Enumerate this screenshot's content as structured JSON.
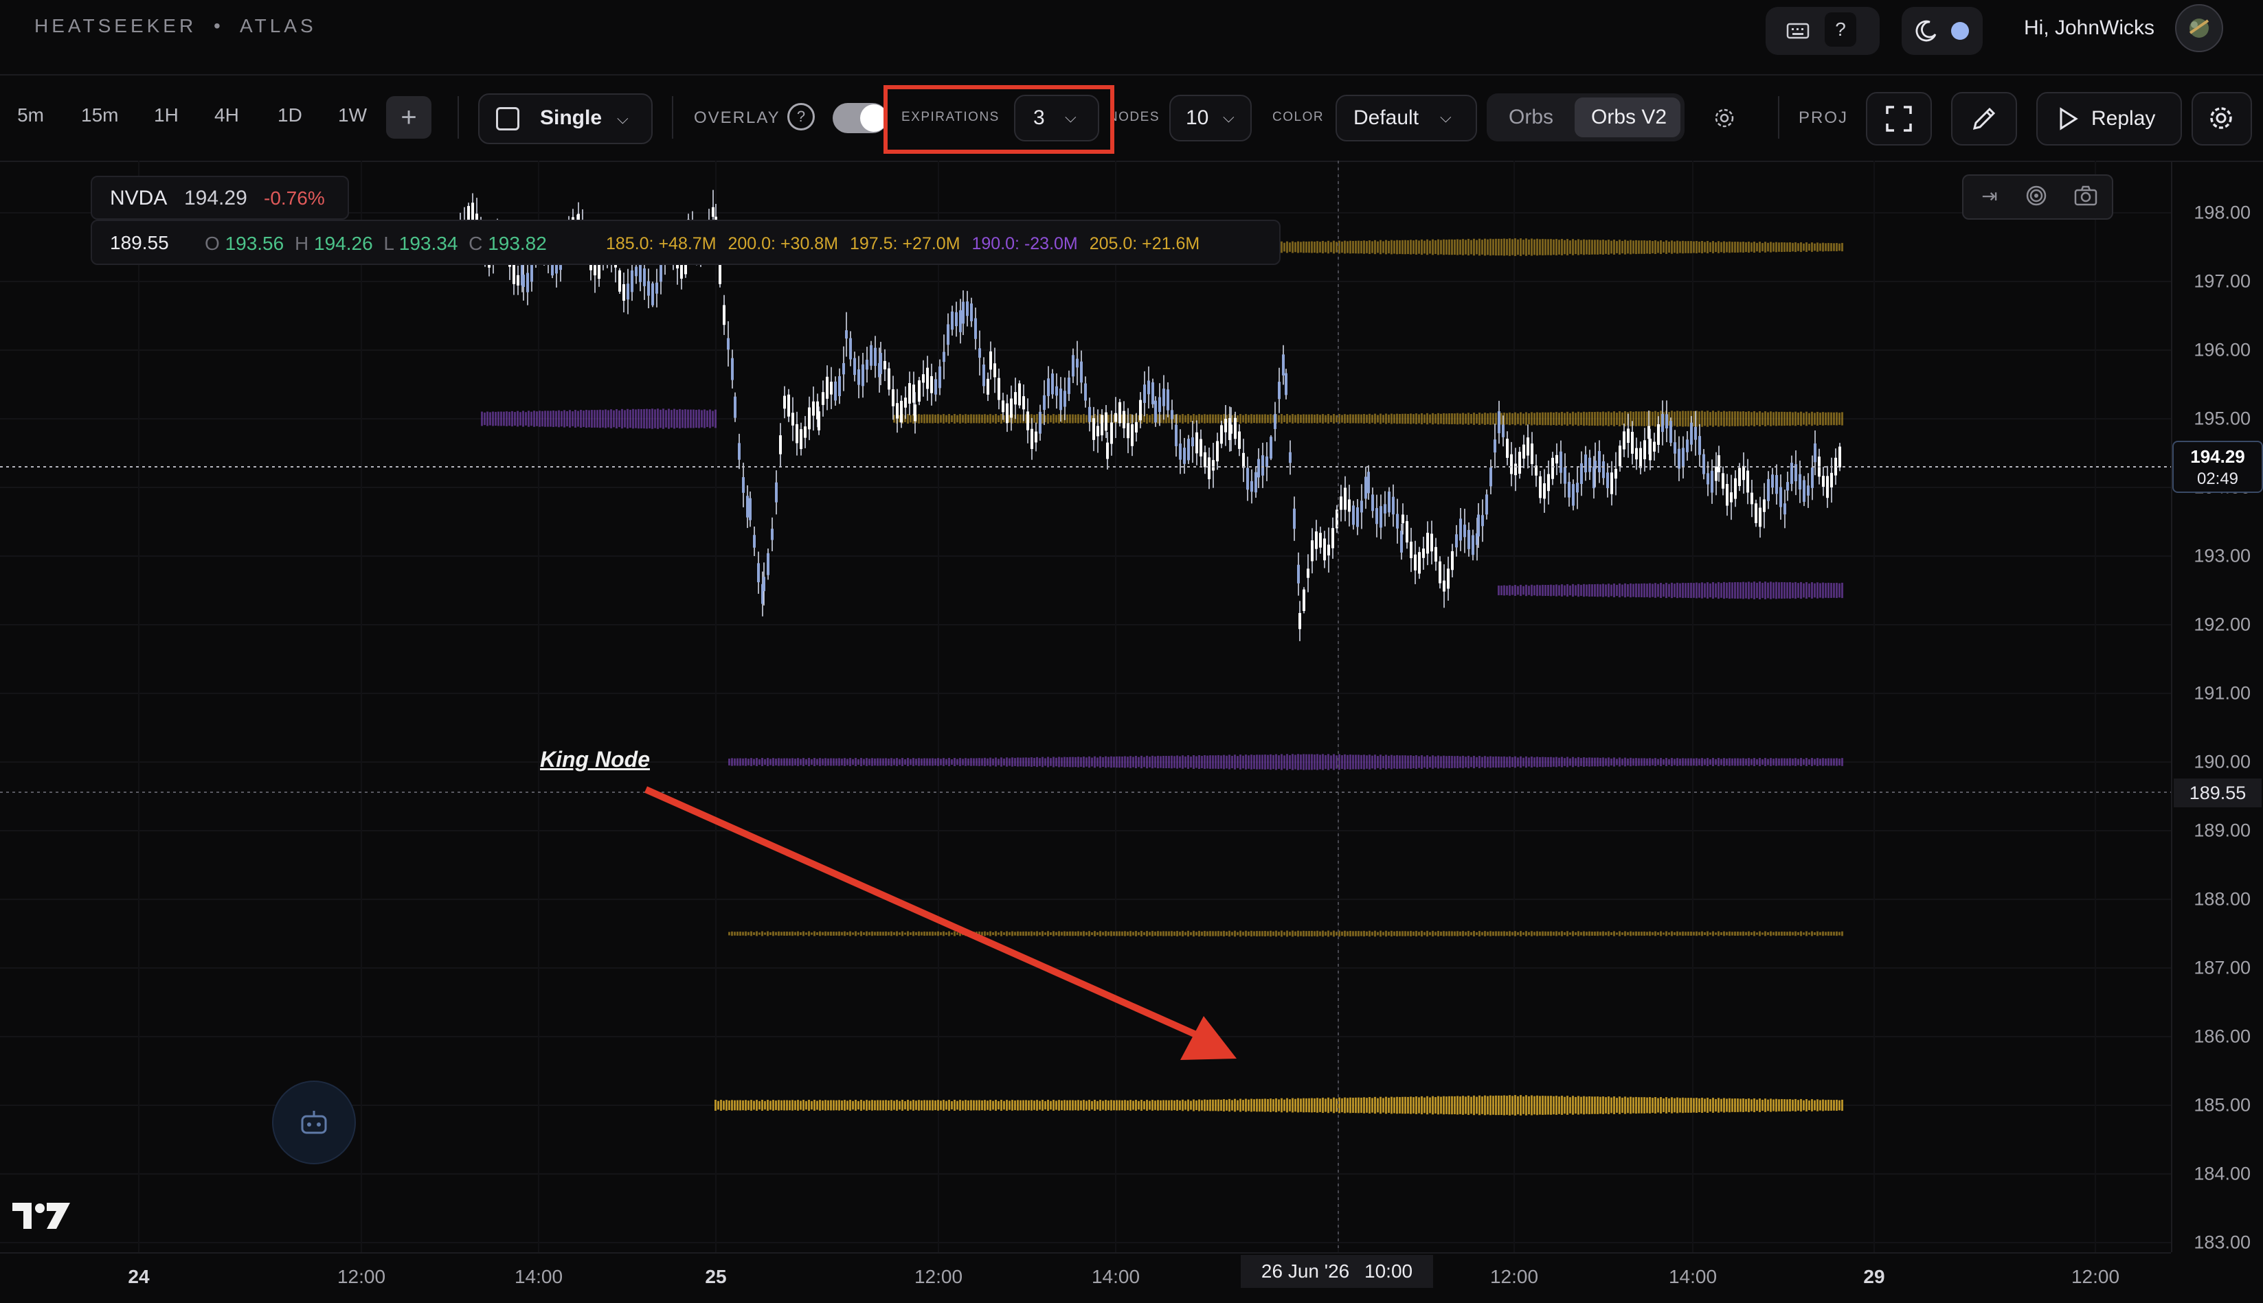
{
  "header": {
    "brand": "HEATSEEKER",
    "brand_sep": "•",
    "product": "ATLAS",
    "help_glyph": "?",
    "greeting": "Hi, JohnWicks"
  },
  "toolbar": {
    "timeframes": [
      "5m",
      "15m",
      "1H",
      "4H",
      "1D",
      "1W"
    ],
    "add_glyph": "+",
    "layout_value": "Single",
    "overlay_label": "OVERLAY",
    "help_glyph": "?",
    "expirations_label": "EXPIRATIONS",
    "expirations_value": "3",
    "nodes_label": "NODES",
    "nodes_value": "10",
    "color_label": "COLOR",
    "color_value": "Default",
    "orbs_label": "Orbs",
    "orbs_v2_label": "Orbs V2",
    "proj_label": "PROJ",
    "replay_label": "Replay"
  },
  "legend": {
    "symbol": "NVDA",
    "price": "194.29",
    "change": "-0.76%",
    "ref_price": "189.55",
    "o_label": "O",
    "o": "193.56",
    "h_label": "H",
    "h": "194.26",
    "l_label": "L",
    "l": "193.34",
    "c_label": "C",
    "c": "193.82",
    "nodes": [
      {
        "text": "185.0: +48.7M",
        "color": "#d4a72c"
      },
      {
        "text": "200.0: +30.8M",
        "color": "#d4a72c"
      },
      {
        "text": "197.5: +27.0M",
        "color": "#d4a72c"
      },
      {
        "text": "190.0: -23.0M",
        "color": "#8e4fd6"
      },
      {
        "text": "205.0: +21.6M",
        "color": "#d4a72c"
      }
    ]
  },
  "price_axis": {
    "ticks": [
      "198.00",
      "197.00",
      "196.00",
      "195.00",
      "194.00",
      "193.00",
      "192.00",
      "191.00",
      "190.00",
      "189.00",
      "188.00",
      "187.00",
      "186.00",
      "185.00",
      "184.00",
      "183.00"
    ],
    "current_price": "194.29",
    "countdown": "02:49",
    "ref_price": "189.55"
  },
  "time_axis": {
    "ticks": [
      "24",
      "12:00",
      "14:00",
      "25",
      "12:00",
      "14:00",
      "12:00",
      "14:00",
      "29",
      "12:00"
    ],
    "crosshair_date": "26 Jun '26",
    "crosshair_time": "10:00"
  },
  "annotation": {
    "label": "King Node"
  },
  "colors": {
    "gold": "#d4a72c",
    "purple": "#8e4fd6",
    "candle": "#dfe4f5",
    "highlight": "#e23b2a",
    "up": "#4cc38a",
    "down": "#e05a5a"
  }
}
